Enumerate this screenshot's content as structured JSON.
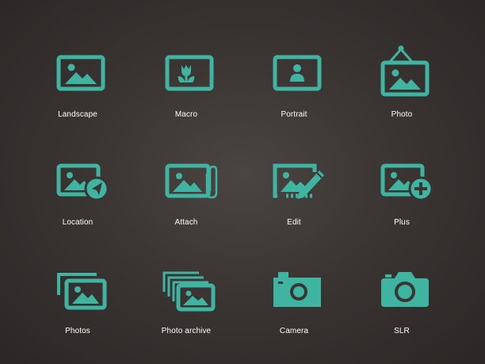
{
  "theme": {
    "accent": "#3fb4a0",
    "background": "#3a3533",
    "label_color": "#ffffff"
  },
  "icons": [
    {
      "label": "Landscape",
      "icon": "landscape-icon"
    },
    {
      "label": "Macro",
      "icon": "macro-icon"
    },
    {
      "label": "Portrait",
      "icon": "portrait-icon"
    },
    {
      "label": "Photo",
      "icon": "hanging-photo-icon"
    },
    {
      "label": "Location",
      "icon": "photo-location-icon"
    },
    {
      "label": "Attach",
      "icon": "photo-attach-icon"
    },
    {
      "label": "Edit",
      "icon": "photo-edit-icon"
    },
    {
      "label": "Plus",
      "icon": "photo-plus-icon"
    },
    {
      "label": "Photos",
      "icon": "photos-stack-icon"
    },
    {
      "label": "Photo archive",
      "icon": "photo-archive-icon"
    },
    {
      "label": "Camera",
      "icon": "camera-icon"
    },
    {
      "label": "SLR",
      "icon": "slr-camera-icon"
    }
  ]
}
